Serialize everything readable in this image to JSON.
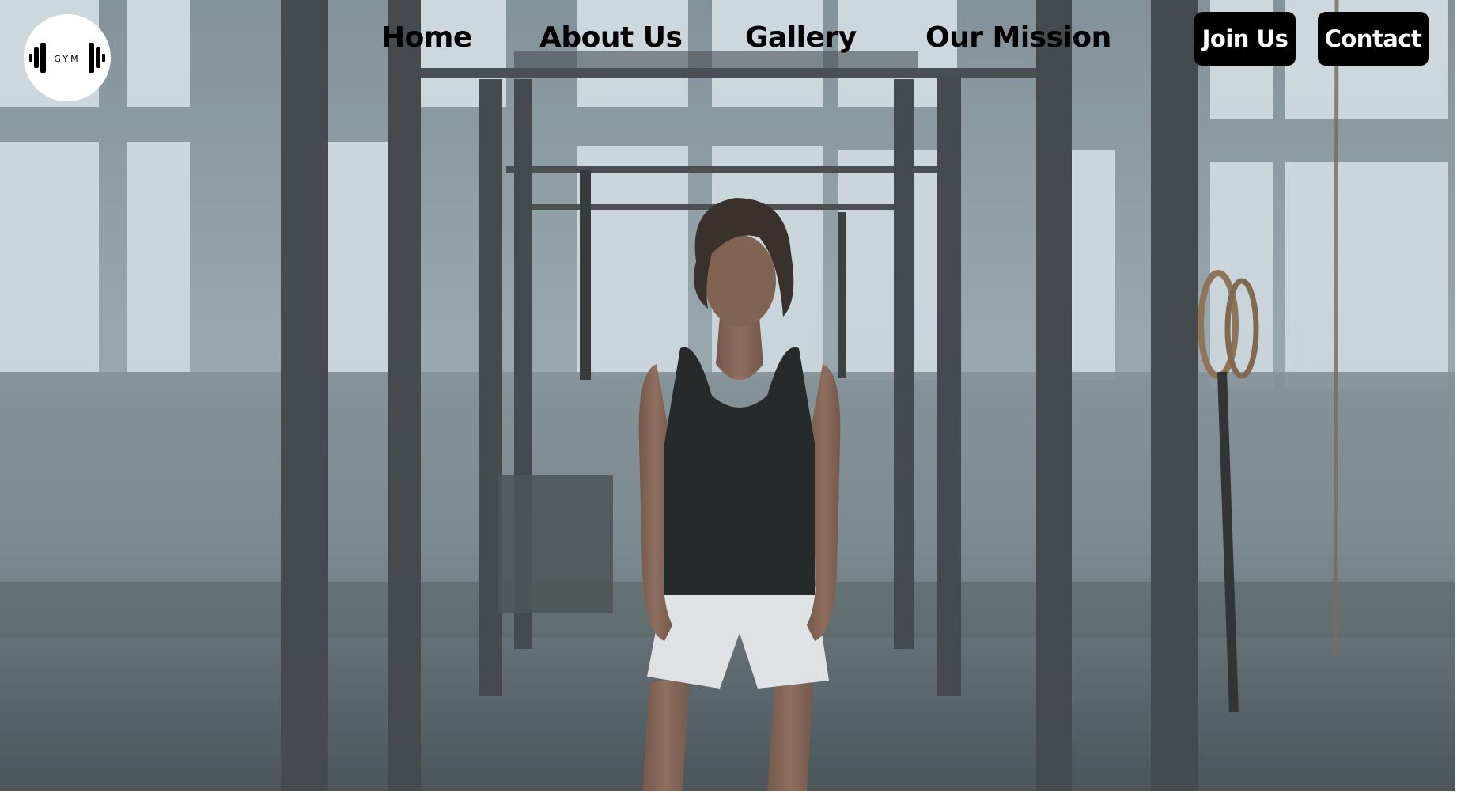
{
  "logo": {
    "text": "GYM",
    "icon": "dumbbell-icon"
  },
  "nav": {
    "items": [
      {
        "label": "Home"
      },
      {
        "label": "About Us"
      },
      {
        "label": "Gallery"
      },
      {
        "label": "Our Mission"
      }
    ]
  },
  "actions": {
    "join_label": "Join Us",
    "contact_label": "Contact"
  },
  "colors": {
    "button_bg": "#000000",
    "button_text": "#ffffff",
    "nav_text": "#000000"
  }
}
